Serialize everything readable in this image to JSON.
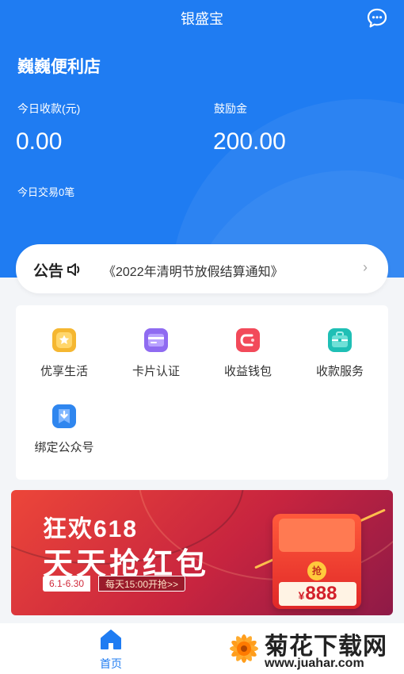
{
  "header": {
    "app_title": "银盛宝",
    "store_name": "巍巍便利店",
    "today_collection_label": "今日收款(元)",
    "today_collection_value": "0.00",
    "bonus_label": "鼓励金",
    "bonus_value": "200.00",
    "today_transactions": "今日交易0笔",
    "chat_icon": "chat-bubble-icon"
  },
  "notice": {
    "tag": "公告",
    "icon": "speaker-icon",
    "text": "《2022年清明节放假结算通知》",
    "arrow": "›"
  },
  "menu": {
    "items": [
      {
        "label": "优享生活",
        "icon": "star-badge-icon",
        "color": "#f5b731"
      },
      {
        "label": "卡片认证",
        "icon": "card-icon",
        "color": "#8f6bf1"
      },
      {
        "label": "收益钱包",
        "icon": "wallet-icon",
        "color": "#f24a5a"
      },
      {
        "label": "收款服务",
        "icon": "briefcase-icon",
        "color": "#1fbfb5"
      },
      {
        "label": "绑定公众号",
        "icon": "download-bookmark-icon",
        "color": "#2f86ef"
      }
    ]
  },
  "banner": {
    "line1": "狂欢618",
    "line2": "天天抢红包",
    "date_range": "6.1-6.30",
    "time_text": "每天15:00开抢>>",
    "coin_text": "抢",
    "currency": "¥",
    "amount": "888"
  },
  "tabbar": {
    "home_label": "首页",
    "home_icon": "home-icon"
  },
  "watermark": {
    "name": "菊花下载网",
    "url": "www.juahar.com"
  },
  "colors": {
    "primary": "#1f7cf2",
    "banner_red": "#e23a3a"
  }
}
